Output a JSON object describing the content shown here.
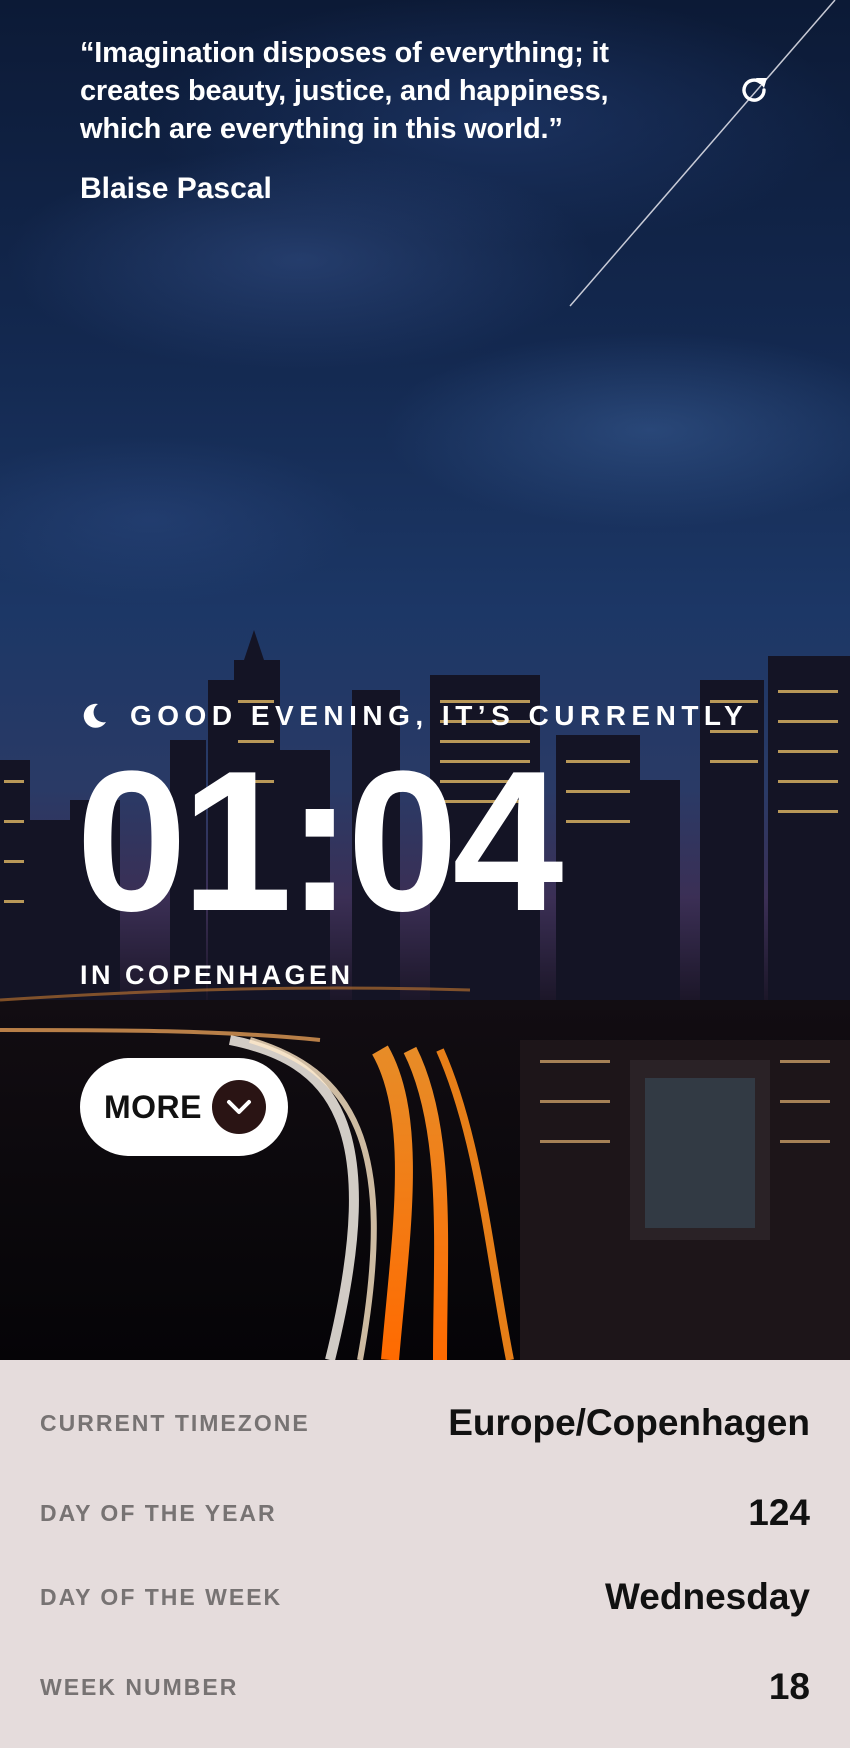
{
  "quote": {
    "text": "“Imagination disposes of everything; it creates beauty, justice, and happiness, which are everything in this world.”",
    "author": "Blaise Pascal",
    "refresh_icon": "refresh-icon"
  },
  "greeting": {
    "icon": "moon-icon",
    "text": "GOOD EVENING, IT’S CURRENTLY"
  },
  "clock": {
    "time": "01:04",
    "location": "IN COPENHAGEN"
  },
  "more_button": {
    "label": "MORE",
    "icon": "chevron-down-icon"
  },
  "info": {
    "rows": [
      {
        "label": "CURRENT TIMEZONE",
        "value": "Europe/Copenhagen"
      },
      {
        "label": "DAY OF THE YEAR",
        "value": "124"
      },
      {
        "label": "DAY OF THE WEEK",
        "value": "Wednesday"
      },
      {
        "label": "WEEK NUMBER",
        "value": "18"
      }
    ]
  },
  "colors": {
    "panel_bg": "#e5dcdc",
    "label_color": "#777373",
    "value_color": "#111111",
    "button_bg": "#ffffff",
    "chevron_bg": "#2a1414"
  }
}
